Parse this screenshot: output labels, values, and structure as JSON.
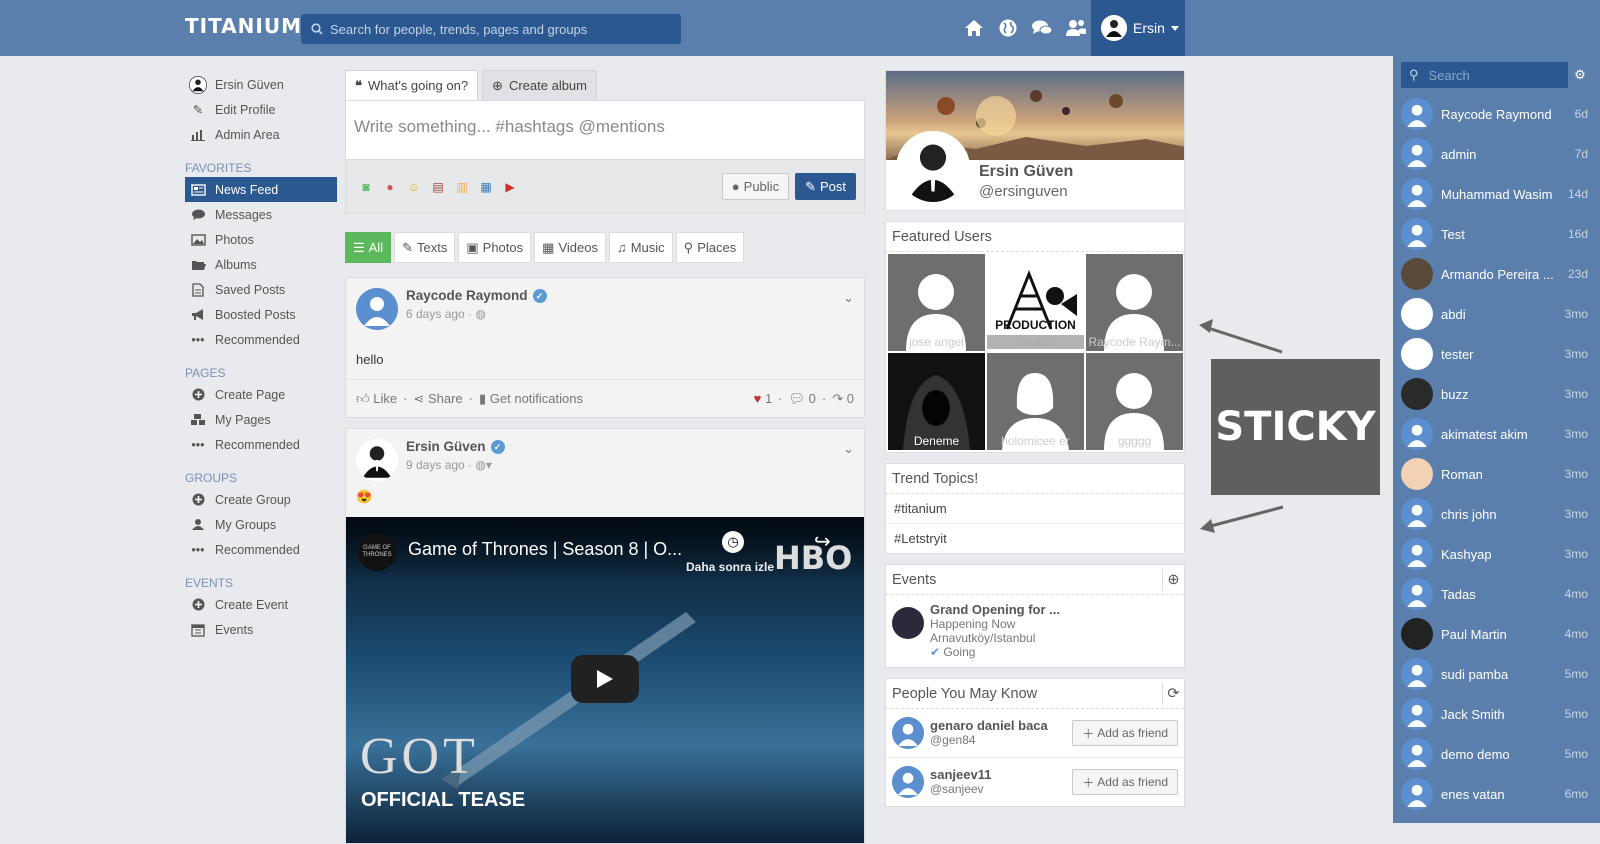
{
  "topbar": {
    "logo": "TITANIUM",
    "search_placeholder": "Search for people, trends, pages and groups",
    "user": "Ersin"
  },
  "leftnav": {
    "profile": "Ersin Güven",
    "edit": "Edit Profile",
    "admin": "Admin Area",
    "favorites_title": "FAVORITES",
    "favorites": [
      "News Feed",
      "Messages",
      "Photos",
      "Albums",
      "Saved Posts",
      "Boosted Posts",
      "Recommended"
    ],
    "pages_title": "PAGES",
    "pages": [
      "Create Page",
      "My Pages",
      "Recommended"
    ],
    "groups_title": "GROUPS",
    "groups": [
      "Create Group",
      "My Groups",
      "Recommended"
    ],
    "events_title": "EVENTS",
    "events": [
      "Create Event",
      "Events"
    ]
  },
  "composer": {
    "tab1": "What's going on?",
    "tab2": "Create album",
    "placeholder": "Write something... #hashtags @mentions",
    "public": "Public",
    "post": "Post"
  },
  "filters": [
    "All",
    "Texts",
    "Photos",
    "Videos",
    "Music",
    "Places"
  ],
  "post1": {
    "author": "Raycode Raymond",
    "time": "6 days ago",
    "text": "hello",
    "like": "Like",
    "share": "Share",
    "notify": "Get notifications",
    "likes": "1",
    "comments": "0",
    "shares": "0"
  },
  "post2": {
    "author": "Ersin Güven",
    "time": "9 days ago",
    "emoji": "😍",
    "video_title": "Game of Thrones | Season 8 | O...",
    "watch_later": "Daha sonra izle",
    "hbo": "HBO",
    "got": "GOT",
    "tease": "OFFICIAL TEASE",
    "channel": "GAME OF THRONES"
  },
  "profilecard": {
    "name": "Ersin Güven",
    "handle": "@ersinguven"
  },
  "featured": {
    "title": "Featured Users",
    "users": [
      "jose angel",
      "sssddd",
      "Raycode Raym...",
      "Deneme",
      "holomicee er",
      "ggggg"
    ],
    "production": "PRODUCTION"
  },
  "trends": {
    "title": "Trend Topics!",
    "items": [
      "#titanium",
      "#Letstryit"
    ]
  },
  "events": {
    "title": "Events",
    "name": "Grand Opening for ...",
    "status": "Happening Now",
    "place": "Arnavutköy/Istanbul",
    "going": "Going"
  },
  "pymk": {
    "title": "People You May Know",
    "add": "Add as friend",
    "people": [
      {
        "name": "genaro daniel baca",
        "handle": "@gen84"
      },
      {
        "name": "sanjeev11",
        "handle": "@sanjeev"
      }
    ]
  },
  "sticky": "STICKY",
  "chat": {
    "search": "Search",
    "rows": [
      {
        "name": "Raycode Raymond",
        "time": "6d"
      },
      {
        "name": "admin",
        "time": "7d"
      },
      {
        "name": "Muhammad Wasim",
        "time": "14d"
      },
      {
        "name": "Test",
        "time": "16d"
      },
      {
        "name": "Armando Pereira ...",
        "time": "23d"
      },
      {
        "name": "abdi",
        "time": "3mo"
      },
      {
        "name": "tester",
        "time": "3mo"
      },
      {
        "name": "buzz",
        "time": "3mo"
      },
      {
        "name": "akimatest akim",
        "time": "3mo"
      },
      {
        "name": "Roman",
        "time": "3mo"
      },
      {
        "name": "chris john",
        "time": "3mo"
      },
      {
        "name": "Kashyap",
        "time": "3mo"
      },
      {
        "name": "Tadas",
        "time": "4mo"
      },
      {
        "name": "Paul Martin",
        "time": "4mo"
      },
      {
        "name": "sudi pamba",
        "time": "5mo"
      },
      {
        "name": "Jack Smith",
        "time": "5mo"
      },
      {
        "name": "demo demo",
        "time": "5mo"
      },
      {
        "name": "enes vatan",
        "time": "6mo"
      }
    ]
  }
}
